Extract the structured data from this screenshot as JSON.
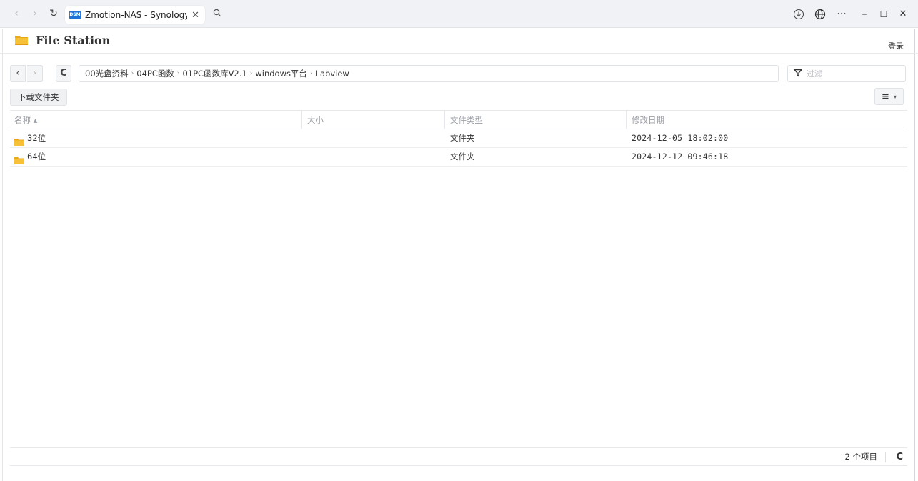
{
  "browser": {
    "tab_favicon_text": "DSM",
    "tab_title": "Zmotion-NAS - Synology N",
    "controls": {
      "back": "‹",
      "forward": "›",
      "reload": "↻",
      "close_tab": "✕",
      "search": "🔍",
      "downloads": "⤓",
      "language": "⊕",
      "more": "···",
      "minimize": "–",
      "maximize": "☐",
      "close_window": "✕"
    }
  },
  "app": {
    "title": "File Station",
    "login_label": "登录"
  },
  "toolbar": {
    "back": "‹",
    "forward": "›",
    "refresh": "C",
    "breadcrumb": [
      "00光盘资料",
      "04PC函数",
      "01PC函数库V2.1",
      "windows平台",
      "Labview"
    ],
    "breadcrumb_separator": "›",
    "filter_icon": "⛛",
    "filter_placeholder": "过滤",
    "download_folder_label": "下载文件夹",
    "view_icon": "≡",
    "view_caret": "▾"
  },
  "table": {
    "columns": {
      "name": "名称 ▴",
      "size": "大小",
      "type": "文件类型",
      "modified": "修改日期"
    },
    "rows": [
      {
        "name": "32位",
        "size": "",
        "type": "文件夹",
        "modified": "2024-12-05 18:02:00"
      },
      {
        "name": "64位",
        "size": "",
        "type": "文件夹",
        "modified": "2024-12-12 09:46:18"
      }
    ]
  },
  "footer": {
    "item_count": "2 个项目",
    "refresh": "C"
  },
  "colors": {
    "folder_yellow": "#f7c137",
    "folder_dark": "#e8a91c",
    "accent_blue": "#1e73d8"
  }
}
